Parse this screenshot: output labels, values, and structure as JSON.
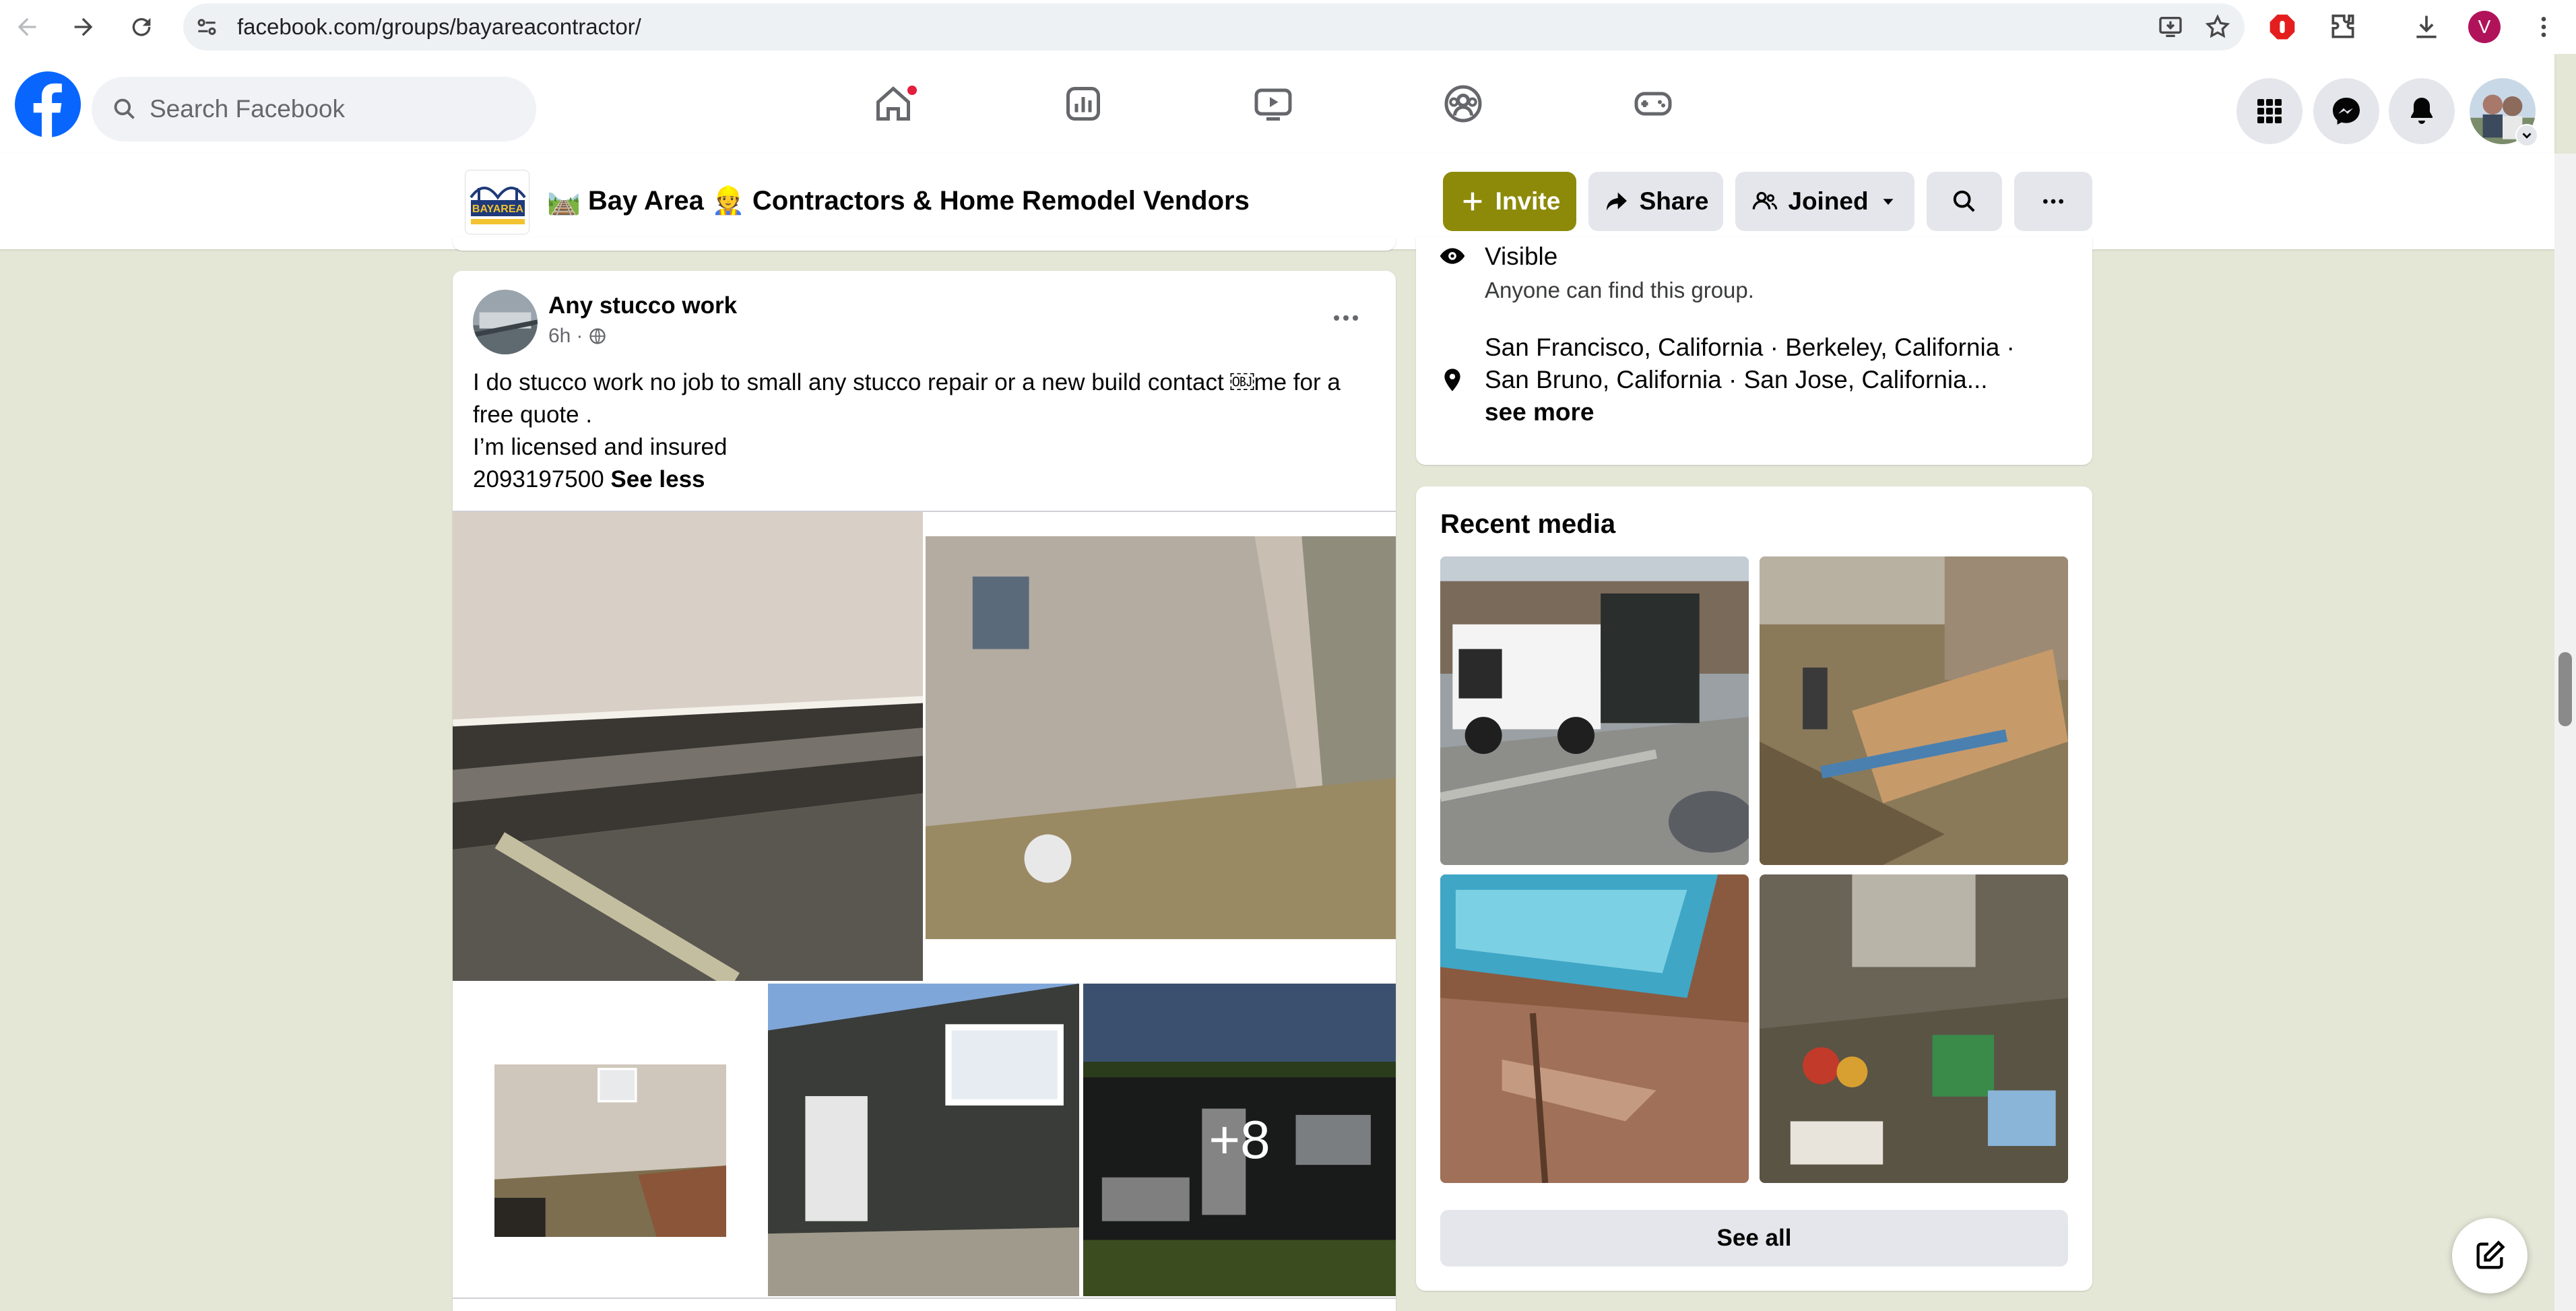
{
  "browser": {
    "url": "facebook.com/groups/bayareacontractor/",
    "profile_initial": "V"
  },
  "fb_nav": {
    "search_placeholder": "Search Facebook"
  },
  "group": {
    "title": "🛤️ Bay Area 👷 Contractors & Home Remodel Vendors",
    "thumb_text": "BAYAREA",
    "buttons": {
      "invite": "Invite",
      "share": "Share",
      "joined": "Joined"
    }
  },
  "post": {
    "author": "Any stucco work",
    "time": "6h",
    "separator": "·",
    "lines": [
      "I do stucco work no job to small any stucco repair or a new build contact ￼me for a free quote .",
      "I’m licensed and insured"
    ],
    "phone": "2093197500",
    "see_less": "See less",
    "more_photos": "+8"
  },
  "about": {
    "visibility_title": "Visible",
    "visibility_desc": "Anyone can find this group.",
    "location_line1": "San Francisco, California · Berkeley, California ·",
    "location_line2": "San Bruno, California · San Jose, California...",
    "see_more": "see more"
  },
  "media": {
    "title": "Recent media",
    "see_all": "See all"
  },
  "colors": {
    "accent": "#8d8a0a",
    "fb_blue": "#0866ff",
    "page_bg": "#e4e6d6"
  }
}
